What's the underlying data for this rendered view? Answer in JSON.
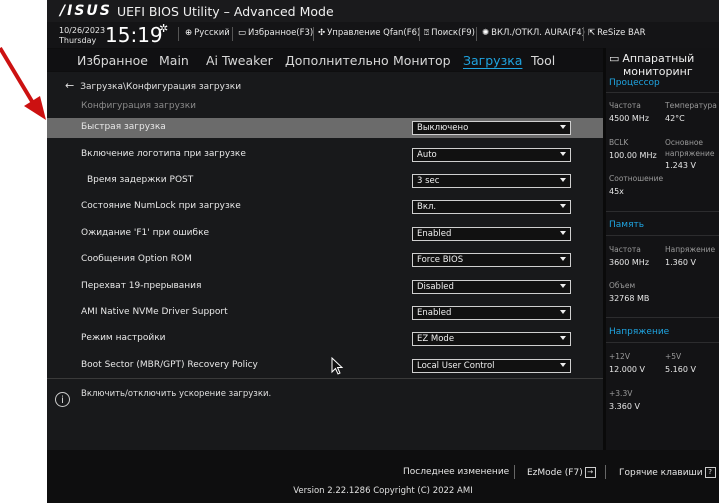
{
  "header": {
    "logo": "/ISUS",
    "title": "UEFI BIOS Utility – Advanced Mode",
    "date": "10/26/2023",
    "weekday": "Thursday",
    "time": "15:19",
    "tools": [
      {
        "icon": "globe-icon",
        "label": "Русский"
      },
      {
        "icon": "favorites-icon",
        "label": "Избранное(F3)"
      },
      {
        "icon": "fan-icon",
        "label": "Управление Qfan(F6)"
      },
      {
        "icon": "help-search-icon",
        "label": "Поиск(F9)"
      },
      {
        "icon": "aura-icon",
        "label": "ВКЛ./ОТКЛ. AURA(F4)"
      },
      {
        "icon": "resize-bar-icon",
        "label": "ReSize BAR"
      }
    ]
  },
  "menu": [
    "Избранное",
    "Main",
    "Ai Tweaker",
    "Дополнительно",
    "Монитор",
    "Загрузка",
    "Tool"
  ],
  "breadcrumb": "Загрузка\\Конфигурация загрузки",
  "subtitle": "Конфигурация загрузки",
  "settings": [
    {
      "label": "Быстрая загрузка",
      "value": "Выключено"
    },
    {
      "label": "Включение логотипа при загрузке",
      "value": "Auto"
    },
    {
      "label": "Время задержки POST",
      "value": "3 sec"
    },
    {
      "label": "Состояние NumLock при загрузке",
      "value": "Вкл."
    },
    {
      "label": "Ожидание 'F1' при ошибке",
      "value": "Enabled"
    },
    {
      "label": "Сообщения Option ROM",
      "value": "Force BIOS"
    },
    {
      "label": "Перехват 19-прерывания",
      "value": "Disabled"
    },
    {
      "label": "AMI Native NVMe Driver Support",
      "value": "Enabled"
    },
    {
      "label": "Режим настройки",
      "value": "EZ Mode"
    },
    {
      "label": "Boot Sector (MBR/GPT) Recovery Policy",
      "value": "Local User Control"
    }
  ],
  "help": "Включить/отключить ускорение загрузки.",
  "hw": {
    "title_line1": "Аппаратный",
    "title_line2": "мониторинг",
    "cpu": {
      "heading": "Процессор",
      "freq_label": "Частота",
      "freq": "4500 MHz",
      "temp_label": "Температура",
      "temp": "42°C",
      "bclk_label": "BCLK",
      "bclk": "100.00 MHz",
      "core_v_label1": "Основное",
      "core_v_label2": "напряжение",
      "core_v": "1.243 V",
      "ratio_label": "Соотношение",
      "ratio": "45x"
    },
    "memory": {
      "heading": "Память",
      "freq_label": "Частота",
      "freq": "3600 MHz",
      "volt_label": "Напряжение",
      "volt": "1.360 V",
      "size_label": "Объем",
      "size": "32768 MB"
    },
    "voltage": {
      "heading": "Напряжение",
      "v12_label": "+12V",
      "v12": "12.000 V",
      "v5_label": "+5V",
      "v5": "5.160 V",
      "v33_label": "+3.3V",
      "v33": "3.360 V"
    }
  },
  "footer": {
    "last_change": "Последнее изменение",
    "ezmode": "EzMode (F7)",
    "hotkeys": "Горячие клавиши",
    "copyright": "Version 2.22.1286 Copyright (C) 2022 AMI"
  },
  "colors": {
    "accent": "#1fa4e0",
    "selected_row": "#6b6b6b",
    "annotation_arrow": "#cc1111"
  }
}
